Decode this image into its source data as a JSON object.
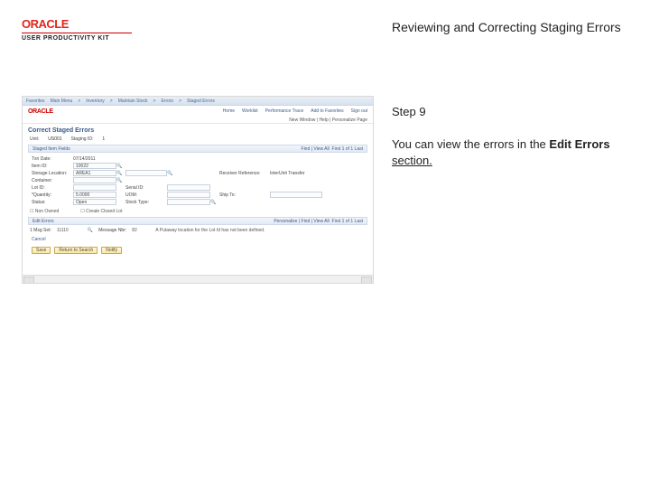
{
  "header": {
    "logo_subtitle": "USER PRODUCTIVITY KIT",
    "page_title": "Reviewing and Correcting Staging Errors"
  },
  "instruction": {
    "step_label": "Step 9",
    "desc_pre": "You can view the errors in the ",
    "desc_bold": "Edit Errors",
    "desc_post": " section."
  },
  "app": {
    "tabs": [
      "Favorites",
      "Main Menu",
      "Inventory",
      "Maintain Stock",
      "Errors",
      "Staged Errors"
    ],
    "brand": "ORACLE",
    "nav": [
      "Home",
      "Worklist",
      "Performance Trace",
      "Add to Favorites",
      "Sign out"
    ],
    "subheader": "New Window | Help | Personalize Page",
    "screen_title": "Correct Staged Errors",
    "meta": {
      "unit_label": "Unit:",
      "unit_val": "US001",
      "staging_label": "Staging ID:",
      "staging_val": "1"
    },
    "section1": {
      "title": "Staged Item Fields",
      "find": "Find | View All",
      "pager": "First 1 of 1 Last"
    },
    "fields": {
      "txn_date_lbl": "Txn Date:",
      "txn_date_val": "07/14/2011",
      "item_lbl": "Item ID:",
      "item_val": "10022",
      "storage_loc_lbl": "Storage Location:",
      "storage_loc_val": "AREA1",
      "container_lbl": "Container:",
      "container_val": "",
      "lot_lbl": "Lot ID:",
      "lot_val": "",
      "serial_lbl": "Serial ID:",
      "serial_val": "",
      "recv_lbl": "Receiver Reference:",
      "recv_val": "InterUnit Transfer",
      "qty_lbl": "*Quantity:",
      "qty_val": "5.0000",
      "uom_lbl": "UOM:",
      "uom_val": "",
      "status_lbl": "Status:",
      "status_val": "Open",
      "stock_lbl": "Stock Type:",
      "stock_val": "",
      "ship_lbl": "Ship To:",
      "ship_val": ""
    },
    "checks": {
      "non_owned": "Non Owned",
      "create_closed": "Create Closed Lot"
    },
    "section2": {
      "title": "Edit Errors",
      "personalize": "Personalize | Find | View All",
      "pager": "First 1 of 1 Last"
    },
    "errors": {
      "msgset_lbl": "1 Msg Set:",
      "msgset_val": "11110",
      "msgnbr_lbl": "Message Nbr:",
      "msgnbr_val": "82",
      "msg": "A Putaway location for the Lot Id has not been defined."
    },
    "cancel": "Cancel",
    "buttons": {
      "save": "Save",
      "prev": "Return to Search",
      "notify": "Notify"
    }
  }
}
